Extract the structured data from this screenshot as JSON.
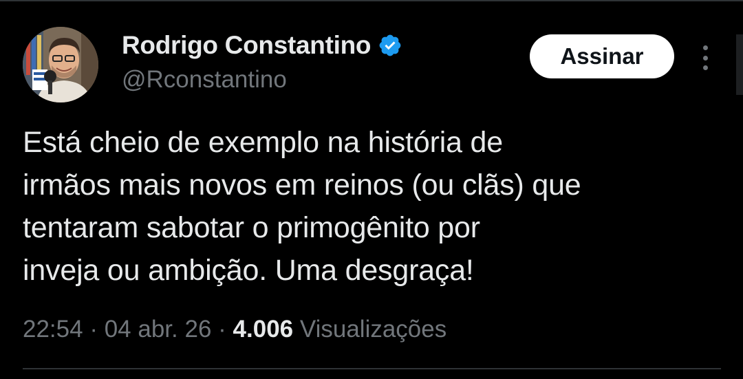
{
  "author": {
    "display_name": "Rodrigo Constantino",
    "handle": "@Rconstantino",
    "verified": true,
    "verified_color": "#1d9bf0",
    "avatar_icon": "profile-photo"
  },
  "actions": {
    "subscribe_label": "Assinar",
    "more_icon": "more-vertical-icon"
  },
  "tweet": {
    "text": "Está cheio de exemplo na história de\nirmãos mais novos em reinos (ou clãs) que\ntentaram sabotar o primogênito por\ninveja ou ambição. Uma desgraça!"
  },
  "meta": {
    "time": "22:54",
    "separator": "·",
    "date": "04 abr. 26",
    "views_count": "4.006",
    "views_label": "Visualizações"
  },
  "colors": {
    "background": "#000000",
    "text_primary": "#e7e9ea",
    "text_secondary": "#71767b",
    "button_bg": "#ffffff",
    "divider": "#2f3336"
  }
}
